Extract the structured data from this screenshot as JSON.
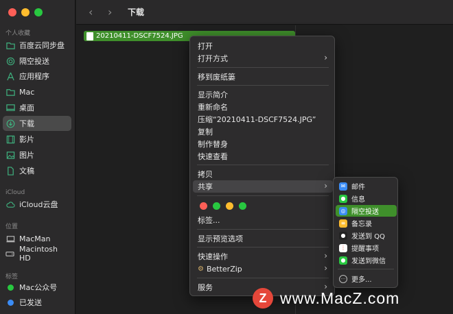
{
  "toolbar": {
    "back": "‹",
    "forward": "›",
    "title": "下载"
  },
  "sidebar": {
    "favorites_title": "个人收藏",
    "favorites": [
      {
        "label": "百度云同步盘",
        "icon": "folder-icon"
      },
      {
        "label": "隔空投送",
        "icon": "airdrop-icon"
      },
      {
        "label": "应用程序",
        "icon": "applications-icon"
      },
      {
        "label": "Mac",
        "icon": "folder-icon"
      },
      {
        "label": "桌面",
        "icon": "desktop-icon"
      },
      {
        "label": "下载",
        "icon": "downloads-icon"
      },
      {
        "label": "影片",
        "icon": "movies-icon"
      },
      {
        "label": "图片",
        "icon": "pictures-icon"
      },
      {
        "label": "文稿",
        "icon": "document-icon"
      }
    ],
    "icloud_title": "iCloud",
    "icloud": [
      {
        "label": "iCloud云盘",
        "icon": "cloud-icon"
      }
    ],
    "locations_title": "位置",
    "locations": [
      {
        "label": "MacMan",
        "icon": "computer-icon"
      },
      {
        "label": "Macintosh HD",
        "icon": "disk-icon"
      }
    ],
    "tags_title": "标签",
    "tags": [
      {
        "label": "Mac公众号",
        "color": "#28c840"
      },
      {
        "label": "已发送",
        "color": "#3b8cf5"
      }
    ]
  },
  "file": {
    "name": "20210411-DSCF7524.JPG"
  },
  "menu": {
    "open": "打开",
    "open_with": "打开方式",
    "trash": "移到废纸篓",
    "get_info": "显示简介",
    "rename": "重新命名",
    "compress": "压缩“20210411-DSCF7524.JPG”",
    "duplicate": "复制",
    "make_alias": "制作替身",
    "quick_look": "快速查看",
    "copy": "拷贝",
    "share": "共享",
    "tags_label": "标签...",
    "tag_colors": [
      "#fe5f57",
      "#28c840",
      "#febc2e",
      "#28c840"
    ],
    "preview_options": "显示预览选项",
    "quick_actions": "快速操作",
    "betterzip": "BetterZip",
    "services": "服务"
  },
  "submenu": {
    "items": [
      {
        "label": "邮件",
        "icon": "mail-icon",
        "color": "#3b8cf5"
      },
      {
        "label": "信息",
        "icon": "messages-icon",
        "color": "#28c840"
      },
      {
        "label": "隔空投送",
        "icon": "airdrop-icon",
        "color": "#3b8cf5"
      },
      {
        "label": "备忘录",
        "icon": "notes-icon",
        "color": "#febc2e"
      },
      {
        "label": "发送到 QQ",
        "icon": "qq-icon",
        "color": "#222222"
      },
      {
        "label": "提醒事项",
        "icon": "reminders-icon",
        "color": "#ffffff"
      },
      {
        "label": "发送到微信",
        "icon": "wechat-icon",
        "color": "#28c840"
      }
    ],
    "more": "更多..."
  },
  "watermark": {
    "logo": "Z",
    "text": "www.MacZ.com"
  }
}
